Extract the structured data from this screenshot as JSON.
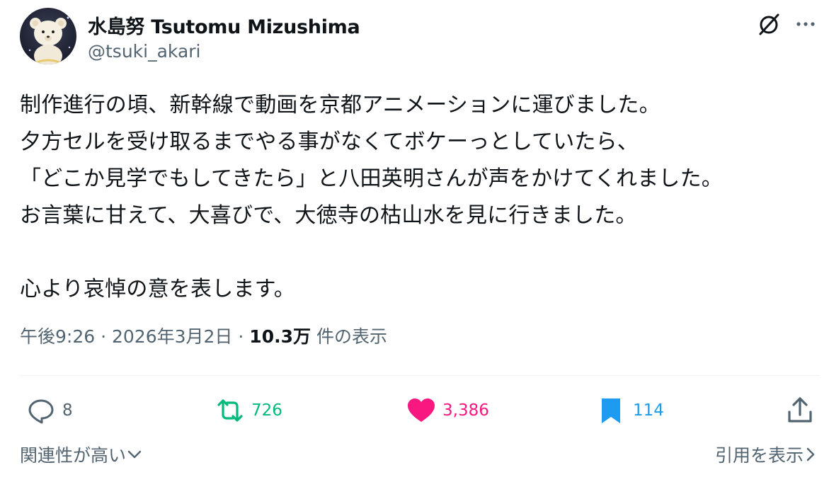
{
  "author": {
    "display_name": "水島努 Tsutomu Mizushima",
    "handle": "@tsuki_akari",
    "avatar_icon": "bear-plush-avatar"
  },
  "header_actions": {
    "grok_icon": "grok-icon",
    "more_icon": "more-icon"
  },
  "post": {
    "lines": [
      "制作進行の頃、新幹線で動画を京都アニメーションに運びました。",
      "夕方セルを受け取るまでやる事がなくてボケーっとしていたら、",
      "「どこか見学でもしてきたら」と八田英明さんが声をかけてくれました。",
      "お言葉に甘えて、大喜びで、大徳寺の枯山水を見に行きました。",
      "",
      "心より哀悼の意を表します。"
    ]
  },
  "meta": {
    "time": "午後9:26",
    "separator": "·",
    "date": "2026年3月2日",
    "views_count": "10.3万",
    "views_label": "件の表示"
  },
  "actions": {
    "reply": {
      "count": "8",
      "icon": "reply-icon",
      "color": "#536471"
    },
    "retweet": {
      "count": "726",
      "icon": "retweet-icon",
      "color": "#00ba7c"
    },
    "like": {
      "count": "3,386",
      "icon": "heart-icon",
      "color": "#f91880"
    },
    "bookmark": {
      "count": "114",
      "icon": "bookmark-icon",
      "color": "#1d9bf0"
    },
    "share": {
      "icon": "share-icon"
    }
  },
  "footer": {
    "sort_label": "関連性が高い",
    "quotes_label": "引用を表示"
  }
}
